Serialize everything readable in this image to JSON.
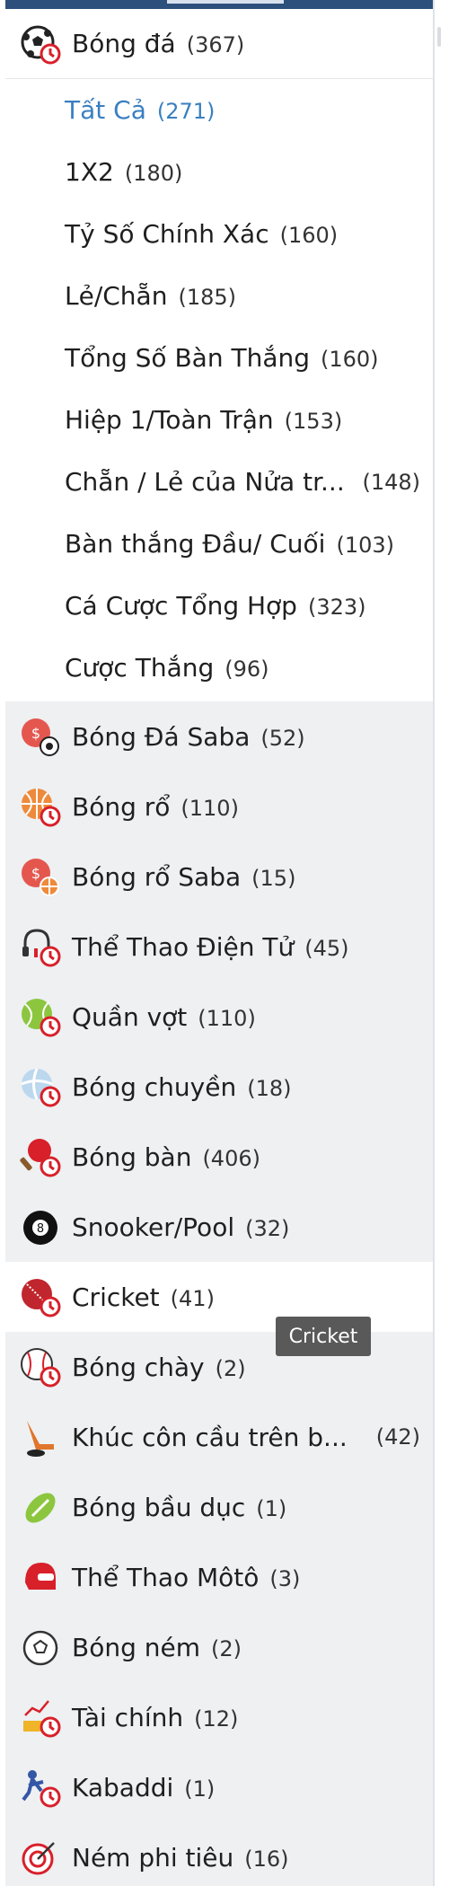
{
  "soccer": {
    "label": "Bóng đá",
    "count": "(367)",
    "submenu": [
      {
        "label": "Tất Cả",
        "count": "(271)",
        "active": true
      },
      {
        "label": "1X2",
        "count": "(180)"
      },
      {
        "label": "Tỷ Số Chính Xác",
        "count": "(160)"
      },
      {
        "label": "Lẻ/Chẵn",
        "count": "(185)"
      },
      {
        "label": "Tổng Số Bàn Thắng",
        "count": "(160)"
      },
      {
        "label": "Hiệp 1/Toàn Trận",
        "count": "(153)"
      },
      {
        "label": "Chẵn / Lẻ của Nửa tr...",
        "count": "(148)"
      },
      {
        "label": "Bàn thắng Đầu/ Cuối",
        "count": "(103)"
      },
      {
        "label": "Cá Cược Tổng Hợp",
        "count": "(323)"
      },
      {
        "label": "Cược Thắng",
        "count": "(96)"
      }
    ]
  },
  "sports": [
    {
      "label": "Bóng Đá Saba",
      "count": "(52)",
      "icon": "saba-soccer-icon"
    },
    {
      "label": "Bóng rổ",
      "count": "(110)",
      "icon": "basketball-icon"
    },
    {
      "label": "Bóng rổ Saba",
      "count": "(15)",
      "icon": "saba-basketball-icon"
    },
    {
      "label": "Thể Thao Điện Tử",
      "count": "(45)",
      "icon": "esports-headset-icon"
    },
    {
      "label": "Quần vợt",
      "count": "(110)",
      "icon": "tennis-icon"
    },
    {
      "label": "Bóng chuyền",
      "count": "(18)",
      "icon": "volleyball-icon"
    },
    {
      "label": "Bóng bàn",
      "count": "(406)",
      "icon": "table-tennis-icon"
    },
    {
      "label": "Snooker/Pool",
      "count": "(32)",
      "icon": "billiard-8-ball-icon"
    },
    {
      "label": "Cricket",
      "count": "(41)",
      "icon": "cricket-ball-icon"
    },
    {
      "label": "Bóng chày",
      "count": "(2)",
      "icon": "baseball-icon"
    },
    {
      "label": "Khúc côn cầu trên b...",
      "count": "(42)",
      "icon": "ice-hockey-icon"
    },
    {
      "label": "Bóng bầu dục",
      "count": "(1)",
      "icon": "rugby-ball-icon"
    },
    {
      "label": "Thể Thao Môtô",
      "count": "(3)",
      "icon": "motorsport-helmet-icon"
    },
    {
      "label": "Bóng ném",
      "count": "(2)",
      "icon": "handball-icon"
    },
    {
      "label": "Tài chính",
      "count": "(12)",
      "icon": "finance-icon"
    },
    {
      "label": "Kabaddi",
      "count": "(1)",
      "icon": "kabaddi-icon"
    },
    {
      "label": "Ném phi tiêu",
      "count": "(16)",
      "icon": "darts-icon"
    }
  ],
  "tooltip": {
    "text": "Cricket"
  },
  "colors": {
    "active": "#3a7fc1",
    "row_grey": "#eef0f2",
    "top_bar": "#2c4f7c",
    "live_clock": "#d8202a"
  }
}
